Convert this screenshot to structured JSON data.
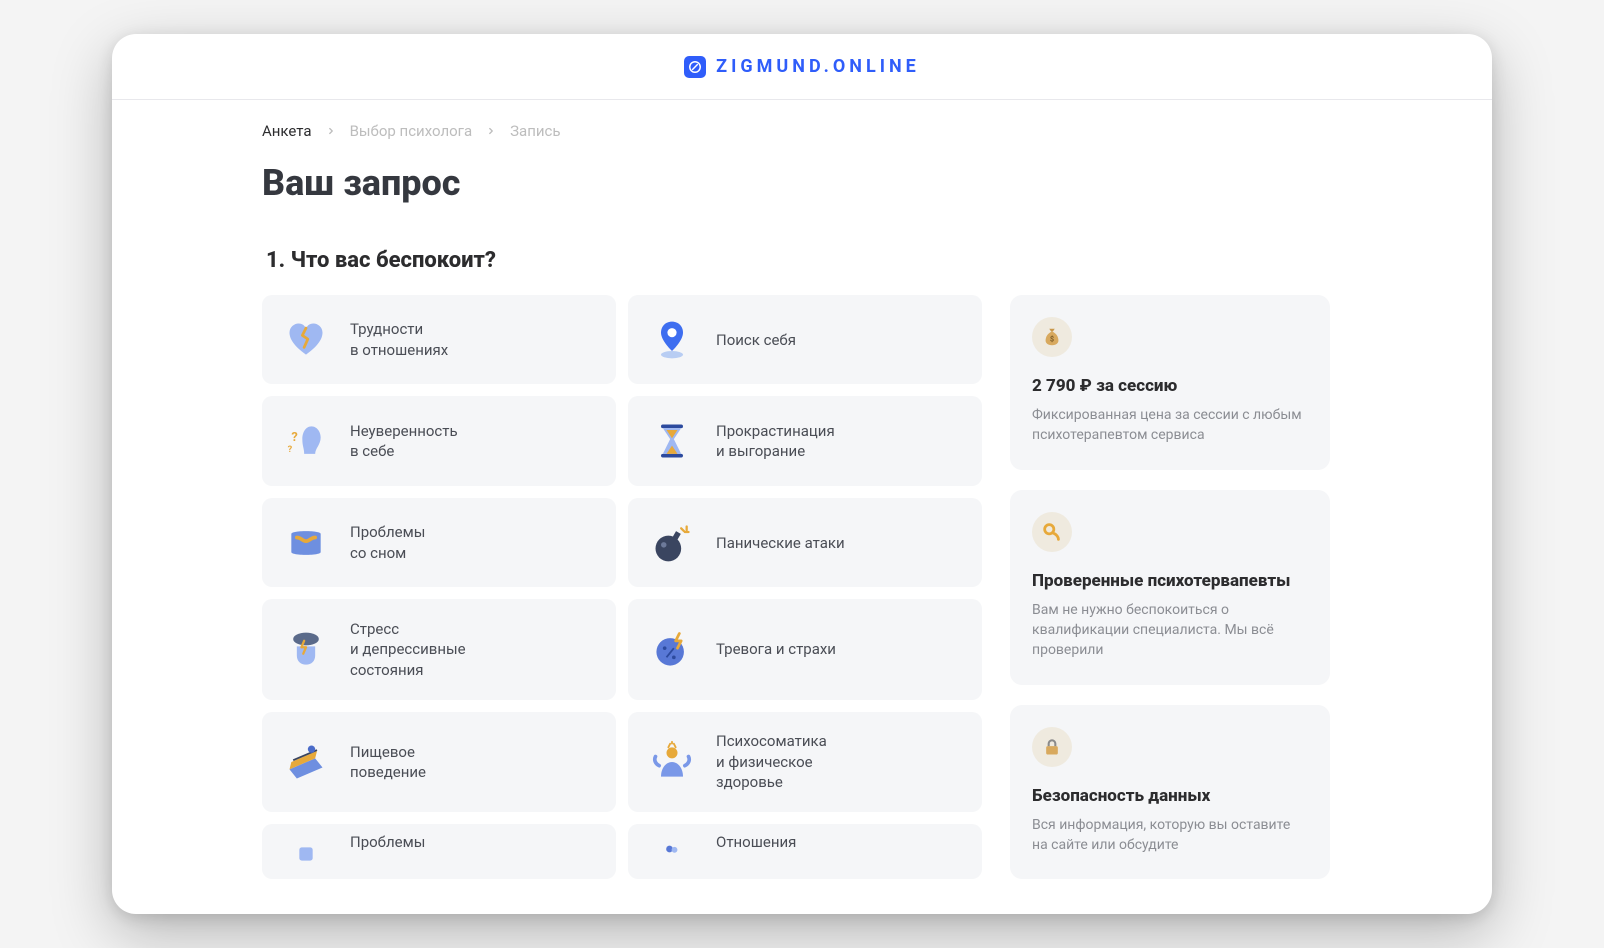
{
  "brand": "ZIGMUND.ONLINE",
  "breadcrumb": {
    "items": [
      "Анкета",
      "Выбор психолога",
      "Запись"
    ],
    "active_index": 0
  },
  "page_title": "Ваш запрос",
  "question_title": "1. Что вас беспокоит?",
  "options": [
    {
      "label": "Трудности\nв отношениях",
      "icon": "broken-heart-icon"
    },
    {
      "label": "Поиск себя",
      "icon": "map-pin-icon"
    },
    {
      "label": "Неуверенность\nв себе",
      "icon": "doubt-icon"
    },
    {
      "label": "Прокрастинация\nи выгорание",
      "icon": "hourglass-icon"
    },
    {
      "label": "Проблемы\nсо сном",
      "icon": "pillow-icon"
    },
    {
      "label": "Панические атаки",
      "icon": "bomb-icon"
    },
    {
      "label": "Стресс\nи депрессивные\nсостояния",
      "icon": "storm-head-icon"
    },
    {
      "label": "Тревога и страхи",
      "icon": "planet-lightning-icon"
    },
    {
      "label": "Пищевое\nповедение",
      "icon": "cake-icon"
    },
    {
      "label": "Психосоматика\nи физическое\nздоровье",
      "icon": "body-health-icon"
    },
    {
      "label": "Проблемы",
      "icon": "generic-icon"
    },
    {
      "label": "Отношения",
      "icon": "balloons-icon"
    }
  ],
  "sidebar": [
    {
      "icon": "money-bag-icon",
      "title": "2 790 ₽ за сессию",
      "text": "Фиксированная цена за сессии с любым психотерапевтом сервиса"
    },
    {
      "icon": "ok-hand-icon",
      "title": "Проверенные психотервапевты",
      "text": "Вам не нужно беспокоиться о квалификации специалиста. Мы всё проверили"
    },
    {
      "icon": "lock-icon",
      "title": "Безопасность данных",
      "text": "Вся информация, которую вы оставите на сайте или обсудите"
    }
  ]
}
